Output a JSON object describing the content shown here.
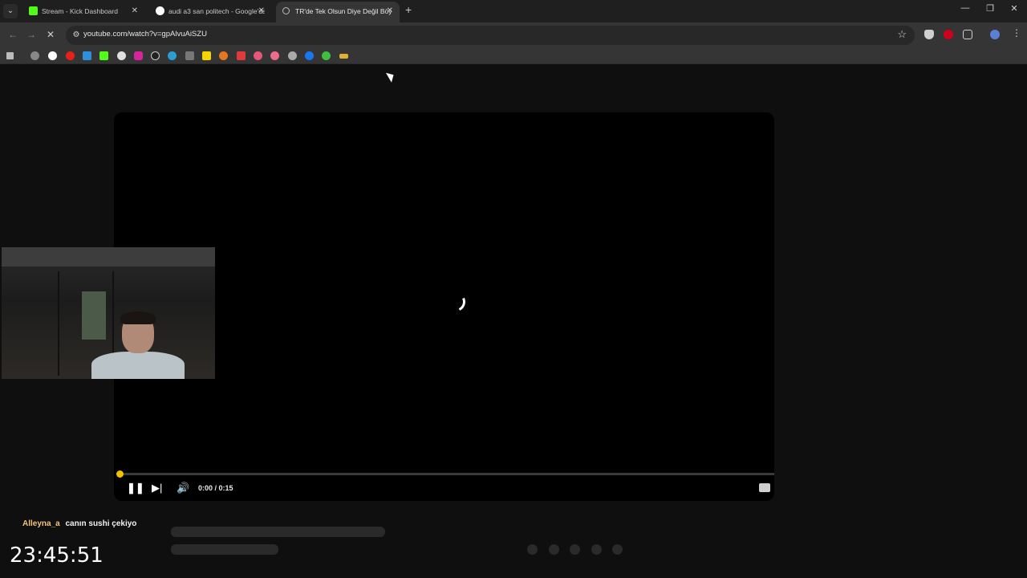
{
  "browser": {
    "tabs": [
      {
        "title": "Stream - Kick Dashboard",
        "close": "✕"
      },
      {
        "title": "audi a3 san politech - Google'da",
        "close": "✕"
      },
      {
        "title": "TR'de Tek Olsun Diye Değil Böyle",
        "close": "✕"
      }
    ],
    "new_tab": "+",
    "url": "youtube.com/watch?v=gpAlvuAiSZU",
    "window_controls": [
      "—",
      "❐",
      "✕"
    ]
  },
  "player": {
    "time": "0:00 / 0:15",
    "progress": 0.0,
    "accent": "#f2c200"
  },
  "overlay": {
    "chat_user": "Alleyna_a",
    "chat_message": "canın sushi çekiyo",
    "clock": "23:45:51"
  },
  "colors": {
    "background": "#0f0f0f",
    "toolbar": "#353535",
    "chat_user": "#f5c27a"
  }
}
